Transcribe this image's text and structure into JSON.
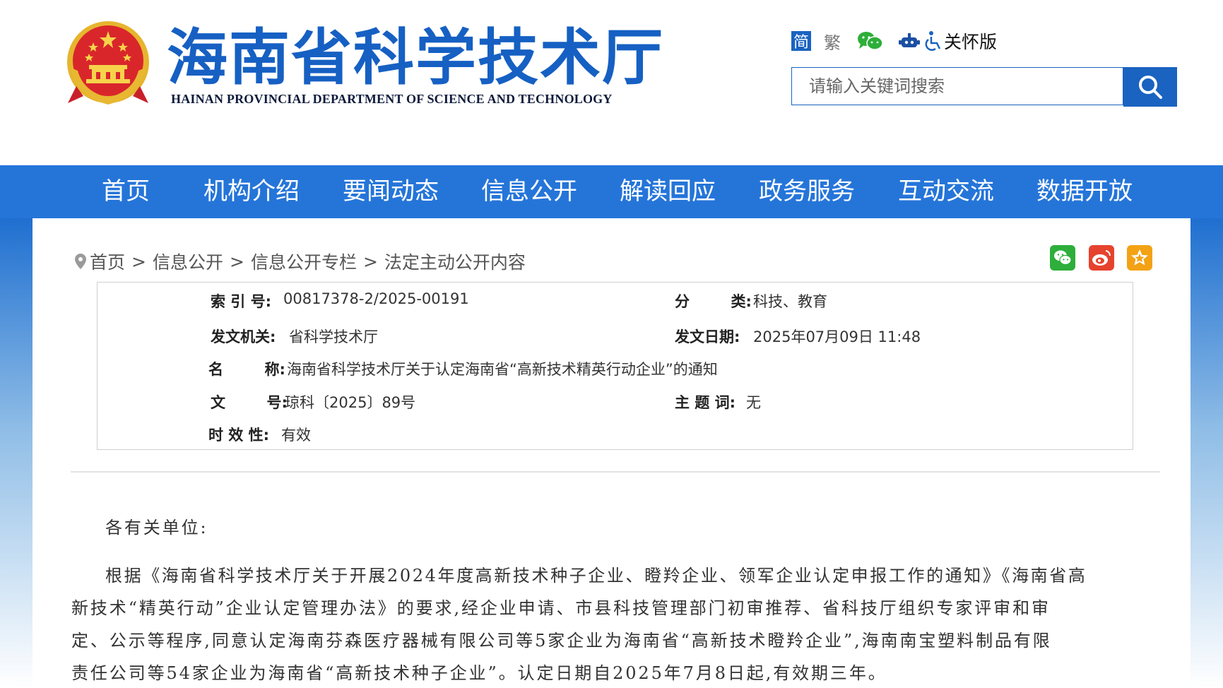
{
  "header": {
    "logo_cn": "海南省科学技术厅",
    "logo_en": "HAINAN PROVINCIAL DEPARTMENT OF SCIENCE AND TECHNOLOGY",
    "lang_simplified": "简",
    "lang_traditional": "繁",
    "care_version": "关怀版",
    "search_placeholder": "请输入关键词搜索",
    "brand_color": "#1a63c0"
  },
  "nav": {
    "items": [
      "首页",
      "机构介绍",
      "要闻动态",
      "信息公开",
      "解读回应",
      "政务服务",
      "互动交流",
      "数据开放"
    ],
    "color": "#2575d9"
  },
  "breadcrumb": [
    "首页",
    "信息公开",
    "信息公开专栏",
    "法定主动公开内容"
  ],
  "breadcrumb_sep": ">",
  "share_icons": [
    "wechat-icon",
    "weibo-icon",
    "favorite-icon"
  ],
  "meta": {
    "index_label": "索 引 号:",
    "index_value": "00817378-2/2025-00191",
    "category_label": "分        类:",
    "category_value": "科技、教育",
    "issuer_label": "发文机关:",
    "issuer_value": "省科学技术厅",
    "date_label": "发文日期:",
    "date_value": "2025年07月09日 11:48",
    "name_label": "名        称:",
    "name_value": "海南省科学技术厅关于认定海南省“高新技术精英行动企业”的通知",
    "docno_label": "文        号:",
    "docno_value": "琼科〔2025〕89号",
    "subject_label": "主 题 词:",
    "subject_value": "无",
    "validity_label": "时 效 性:",
    "validity_value": "有效"
  },
  "body": {
    "salutation": "各有关单位:",
    "lines": [
      "根据《海南省科学技术厅关于开展2024年度高新技术种子企业、瞪羚企业、领军企业认定申报工作的通知》《海南省高",
      "新技术“精英行动”企业认定管理办法》的要求,经企业申请、市县科技管理部门初审推荐、省科技厅组织专家评审和审",
      "定、公示等程序,同意认定海南芬森医疗器械有限公司等5家企业为海南省“高新技术瞪羚企业”,海南南宝塑料制品有限",
      "责任公司等54家企业为海南省“高新技术种子企业”。认定日期自2025年7月8日起,有效期三年。"
    ]
  }
}
